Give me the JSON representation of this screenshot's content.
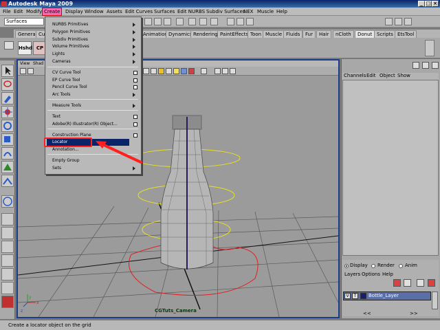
{
  "window": {
    "title": "Autodesk Maya 2009",
    "controls": [
      "_",
      "□",
      "×"
    ]
  },
  "menubar": {
    "items": [
      "File",
      "Edit",
      "Modify",
      "Create",
      "Display",
      "Window",
      "Assets",
      "Edit Curves",
      "Surfaces",
      "Edit NURBS",
      "Subdiv Surfaces",
      "NEX",
      "Muscle",
      "Help"
    ],
    "active": "Create"
  },
  "statusline": {
    "mode": "Surfaces"
  },
  "shelf": {
    "tabs": [
      "General",
      "Cu",
      "Animation",
      "Dynamics",
      "Rendering",
      "PaintEffects",
      "Toon",
      "Muscle",
      "Fluids",
      "Fur",
      "Hair",
      "nCloth",
      "Donut",
      "Scripts",
      "EtsTool"
    ],
    "selected": "Donut",
    "buttons": [
      "Hshd",
      "CP"
    ]
  },
  "create_menu": {
    "items": [
      {
        "label": "NURBS Primitives",
        "arrow": true
      },
      {
        "label": "Polygon Primitives",
        "arrow": true
      },
      {
        "label": "Subdiv Primitives",
        "arrow": true
      },
      {
        "label": "Volume Primitives",
        "arrow": true
      },
      {
        "label": "Lights",
        "arrow": true
      },
      {
        "label": "Cameras",
        "arrow": true
      },
      {
        "label": "CV Curve Tool",
        "box": true
      },
      {
        "label": "EP Curve Tool",
        "box": true
      },
      {
        "label": "Pencil Curve Tool",
        "box": true
      },
      {
        "label": "Arc Tools",
        "arrow": true
      },
      {
        "label": "Measure Tools",
        "arrow": true
      },
      {
        "label": "Text",
        "box": true
      },
      {
        "label": "Adobe(R) Illustrator(R) Object...",
        "box": true
      },
      {
        "label": "Construction Plane",
        "box": true
      },
      {
        "label": "Locator",
        "highlighted": true
      },
      {
        "label": "Annotation..."
      },
      {
        "label": "Empty Group"
      },
      {
        "label": "Sets",
        "arrow": true
      }
    ]
  },
  "viewport": {
    "menu": [
      "View",
      "Shad"
    ],
    "camera_label": "CGTuts_Camera",
    "axis": [
      "x",
      "y",
      "z"
    ]
  },
  "channel_box": {
    "menu": [
      "Channels",
      "Edit",
      "Object",
      "Show"
    ]
  },
  "layer_editor": {
    "modes": [
      "Display",
      "Render",
      "Anim"
    ],
    "selected_mode": "Display",
    "menu": [
      "Layers",
      "Options",
      "Help"
    ],
    "layers": [
      {
        "visible": "V",
        "type": "T",
        "name": "Bottle_Layer",
        "color": "#1a1a7a"
      }
    ],
    "nav": [
      "<<",
      ">>"
    ]
  },
  "helpline": {
    "text": "Create a locator object on the grid"
  },
  "colors": {
    "accent_highlight": "#0a246a",
    "menu_active": "#ff69b4",
    "annotation_red": "#ff2020",
    "ring_yellow": "#e8e020",
    "curve_red": "#e02020"
  }
}
